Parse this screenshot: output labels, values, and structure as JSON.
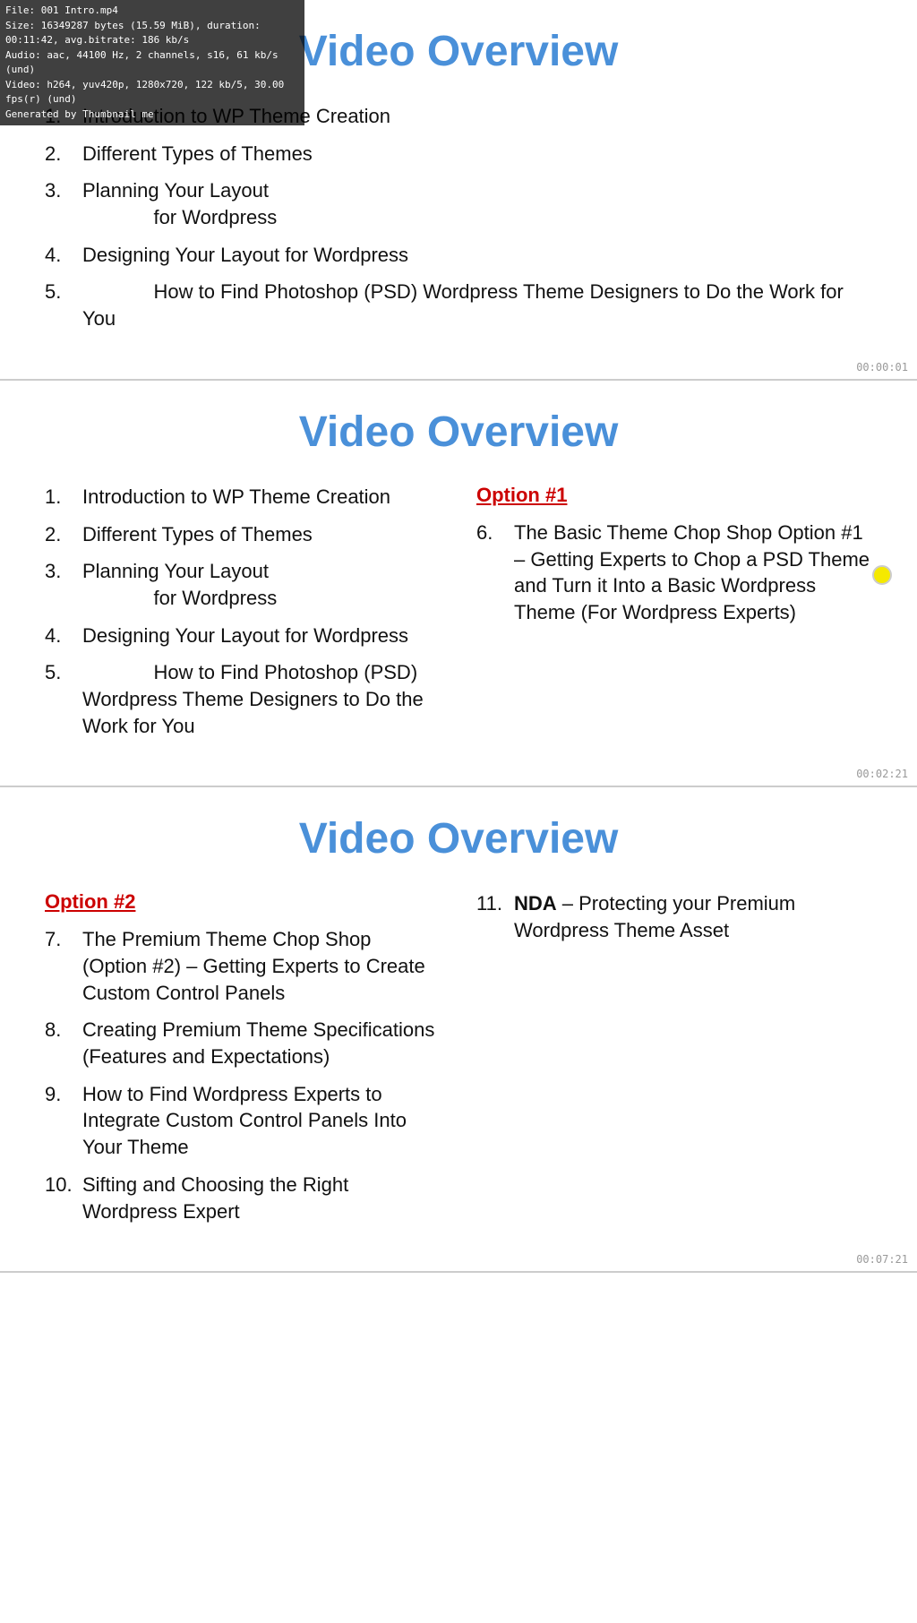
{
  "fileInfo": {
    "line1": "File: 001 Intro.mp4",
    "line2": "Size: 16349287 bytes (15.59 MiB), duration: 00:11:42, avg.bitrate: 186 kb/s",
    "line3": "Audio: aac, 44100 Hz, 2 channels, s16, 61 kb/s (und)",
    "line4": "Video: h264, yuv420p, 1280x720, 122 kb/5, 30.00 fps(r) (und)",
    "line5": "Generated by Thumbnail me"
  },
  "panels": [
    {
      "id": "panel1",
      "title": "Video Overview",
      "timestamp": "00:00:01",
      "leftItems": [
        {
          "num": "1.",
          "text": "Introduction to WP Theme Creation"
        },
        {
          "num": "2.",
          "text": "Different Types of Themes"
        },
        {
          "num": "3.",
          "text": "Planning Your Layout\n             for Wordpress"
        },
        {
          "num": "4.",
          "text": "Designing Your Layout for Wordpress"
        },
        {
          "num": "5.",
          "text": "             How to Find Photoshop (PSD) Wordpress Theme Designers to Do the Work for You"
        }
      ],
      "rightItems": [],
      "optionHeading": null
    },
    {
      "id": "panel2",
      "title": "Video Overview",
      "timestamp": "00:02:21",
      "leftItems": [
        {
          "num": "1.",
          "text": "Introduction to WP Theme Creation"
        },
        {
          "num": "2.",
          "text": "Different Types of Themes"
        },
        {
          "num": "3.",
          "text": "Planning Your Layout\n             for Wordpress"
        },
        {
          "num": "4.",
          "text": "Designing Your Layout for Wordpress"
        },
        {
          "num": "5.",
          "text": "             How to Find Photoshop (PSD) Wordpress Theme Designers to Do the Work for You"
        }
      ],
      "optionHeading": "Option #1",
      "rightItems": [
        {
          "num": "6.",
          "text": "The Basic Theme Chop Shop Option #1 – Getting Experts to Chop a PSD Theme and Turn it Into a Basic Wordpress Theme (For Wordpress Experts)"
        }
      ],
      "showCursor": true
    },
    {
      "id": "panel3",
      "title": "Video Overview",
      "timestamp": "00:07:21",
      "optionHeadingLeft": "Option #2",
      "leftItems": [
        {
          "num": "7.",
          "text": "The Premium Theme Chop Shop (Option #2) – Getting Experts to Create Custom Control Panels"
        },
        {
          "num": "8.",
          "text": "Creating Premium Theme Specifications (Features and Expectations)"
        },
        {
          "num": "9.",
          "text": "How to Find Wordpress Experts to Integrate Custom Control Panels Into Your Theme"
        },
        {
          "num": "10.",
          "text": "Sifting and Choosing the Right Wordpress Expert"
        }
      ],
      "rightItems": [
        {
          "num": "11.",
          "text": "NDA – Protecting your Premium Wordpress Theme Asset"
        }
      ]
    }
  ]
}
